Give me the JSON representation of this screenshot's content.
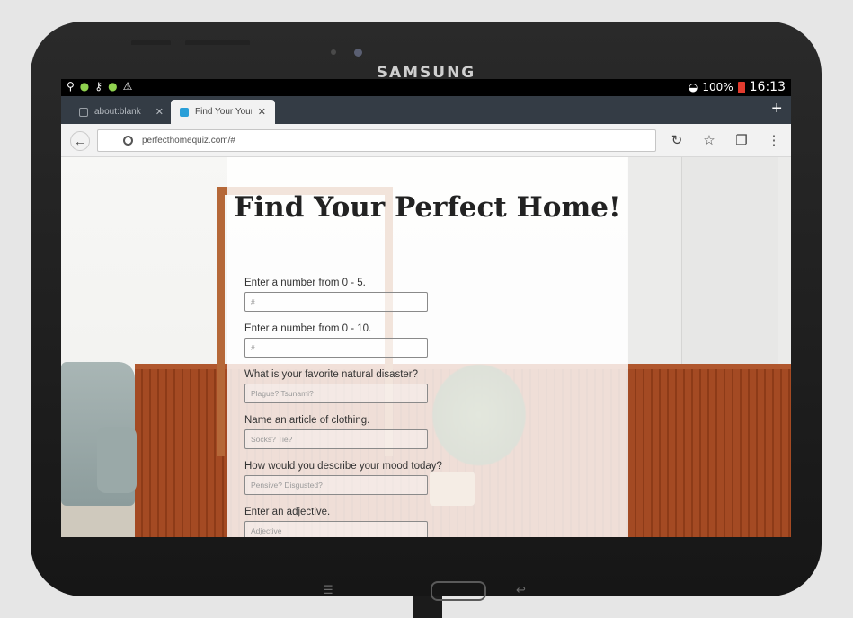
{
  "device": {
    "brand": "SAMSUNG"
  },
  "status_bar": {
    "left_icons": [
      "usb-icon",
      "android-icon",
      "key-icon",
      "android-icon",
      "warning-icon"
    ],
    "battery": "100%",
    "time": "16:13"
  },
  "tabs": [
    {
      "title": "about:blank",
      "active": false
    },
    {
      "title": "Find Your Your Pe",
      "active": true
    }
  ],
  "toolbar": {
    "url": "perfecthomequiz.com/#"
  },
  "page": {
    "title": "Find Your Perfect Home!",
    "questions": [
      {
        "label": "Enter a number from 0 - 5.",
        "placeholder": "#"
      },
      {
        "label": "Enter a number from 0 - 10.",
        "placeholder": "#"
      },
      {
        "label": "What is your favorite natural disaster?",
        "placeholder": "Plague? Tsunami?"
      },
      {
        "label": "Name an article of clothing.",
        "placeholder": "Socks? Tie?"
      },
      {
        "label": "How would you describe your mood today?",
        "placeholder": "Pensive? Disgusted?"
      },
      {
        "label": "Enter an adjective.",
        "placeholder": "Adjective"
      }
    ]
  },
  "colors": {
    "wood": "#a44a23",
    "tabstrip": "#343c45",
    "active_tab_favicon": "#2a9fd8",
    "battery": "#e23b2e"
  }
}
